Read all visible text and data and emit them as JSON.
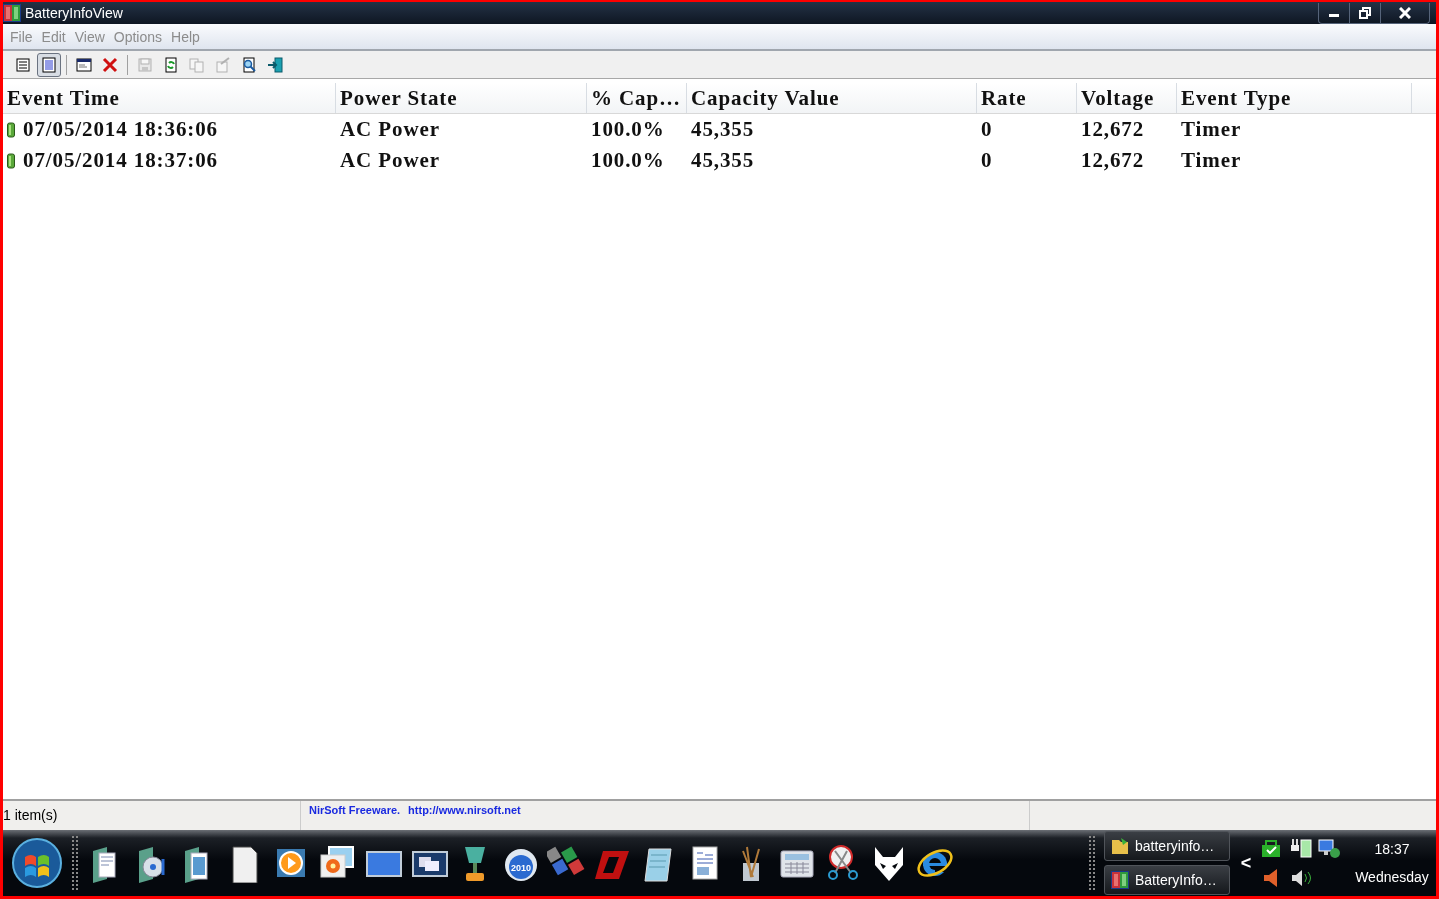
{
  "window": {
    "title": "BatteryInfoView"
  },
  "menu": [
    "File",
    "Edit",
    "View",
    "Options",
    "Help"
  ],
  "toolbar": [
    {
      "selected": false,
      "disabled": false
    },
    {
      "selected": true,
      "disabled": false
    },
    {
      "selected": false,
      "disabled": false
    },
    {
      "selected": false,
      "disabled": false
    },
    {
      "selected": false,
      "disabled": true
    },
    {
      "selected": false,
      "disabled": false
    },
    {
      "selected": false,
      "disabled": true
    },
    {
      "selected": false,
      "disabled": true
    },
    {
      "selected": false,
      "disabled": false
    },
    {
      "selected": false,
      "disabled": false
    }
  ],
  "table": {
    "columns": [
      "Event Time",
      "Power State",
      "% Cap…",
      "Capacity Value",
      "Rate",
      "Voltage",
      "Event Type"
    ],
    "rows": [
      [
        "07/05/2014 18:36:06",
        "AC Power",
        "100.0%",
        "45,355",
        "0",
        "12,672",
        "Timer"
      ],
      [
        "07/05/2014 18:37:06",
        "AC Power",
        "100.0%",
        "45,355",
        "0",
        "12,672",
        "Timer"
      ]
    ]
  },
  "status_bar": {
    "count": "1 item(s)",
    "credit": "NirSoft Freeware.",
    "link": "http://www.nirsoft.net"
  },
  "taskbar": {
    "disc_label": "2010",
    "windows": [
      "batteryinfo…",
      "BatteryInfo…"
    ],
    "tray_chevron": "<",
    "clock": {
      "time": "18:37",
      "day": "Wednesday"
    }
  }
}
